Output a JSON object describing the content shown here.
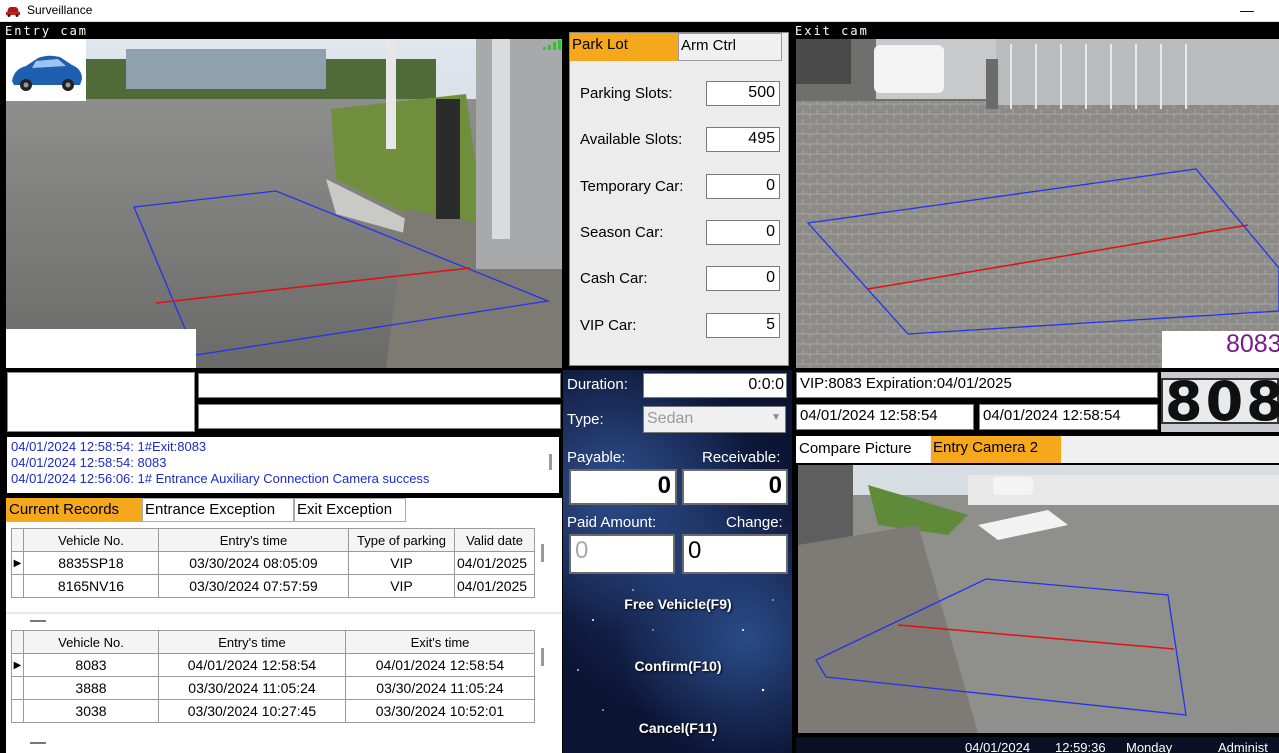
{
  "window": {
    "title": "Surveillance",
    "minimize": "—"
  },
  "entry_cam": {
    "label": "Entry  cam"
  },
  "exit_cam": {
    "label": "Exit  cam",
    "plate_text": "8083",
    "plate_image_text": "808"
  },
  "stats": {
    "tabs": [
      "Park Lot",
      "Arm Ctrl"
    ],
    "rows": [
      {
        "label": "Parking Slots:",
        "value": "500"
      },
      {
        "label": "Available Slots:",
        "value": "495"
      },
      {
        "label": "Temporary Car:",
        "value": "0"
      },
      {
        "label": "Season Car:",
        "value": "0"
      },
      {
        "label": "Cash Car:",
        "value": "0"
      },
      {
        "label": "VIP Car:",
        "value": "5"
      }
    ]
  },
  "billing": {
    "duration_label": "Duration:",
    "duration_value": "0:0:0",
    "type_label": "Type:",
    "type_value": "Sedan",
    "payable_label": "Payable:",
    "receivable_label": "Receivable:",
    "payable_value": "0",
    "receivable_value": "0",
    "paid_label": "Paid Amount:",
    "change_label": "Change:",
    "paid_value": "0",
    "change_value": "0",
    "free_button": "Free Vehicle(F9)",
    "confirm_button": "Confirm(F10)",
    "cancel_button": "Cancel(F11)"
  },
  "exit_info": {
    "vip_line": "VIP:8083 Expiration:04/01/2025",
    "entry_time": "04/01/2024 12:58:54",
    "exit_time": "04/01/2024 12:58:54"
  },
  "compare": {
    "tabs": [
      "Compare Picture",
      "Entry Camera 2"
    ]
  },
  "log": {
    "lines": [
      "04/01/2024 12:58:54: 1#Exit:8083",
      "04/01/2024 12:58:54: 8083",
      "04/01/2024 12:56:06: 1# Entrance Auxiliary Connection Camera success"
    ]
  },
  "record_tabs": [
    "Current Records",
    "Entrance Exception",
    "Exit Exception"
  ],
  "current_records": {
    "columns": [
      "Vehicle No.",
      "Entry's time",
      "Type of parking",
      "Valid date"
    ],
    "rows": [
      [
        "8835SP18",
        "03/30/2024 08:05:09",
        "VIP",
        "04/01/2025"
      ],
      [
        "8165NV16",
        "03/30/2024 07:57:59",
        "VIP",
        "04/01/2025"
      ]
    ]
  },
  "history_records": {
    "columns": [
      "Vehicle No.",
      "Entry's time",
      "Exit's time"
    ],
    "rows": [
      [
        "8083",
        "04/01/2024 12:58:54",
        "04/01/2024 12:58:54"
      ],
      [
        "3888",
        "03/30/2024 11:05:24",
        "03/30/2024 11:05:24"
      ],
      [
        "3038",
        "03/30/2024 10:27:45",
        "03/30/2024 10:52:01"
      ]
    ]
  },
  "statusbar": {
    "date": "04/01/2024",
    "time": "12:59:36",
    "day": "Monday",
    "user": "Administ"
  },
  "colors": {
    "accent": "#f6a81d",
    "log_text": "#1a2bd0",
    "roi_blue": "#2233ee",
    "roi_red": "#e01010",
    "plate_purple": "#7a1a8a"
  },
  "icons": [
    "car-logo-icon",
    "signal-icon",
    "dropdown-arrow-icon",
    "row-pointer-icon"
  ]
}
